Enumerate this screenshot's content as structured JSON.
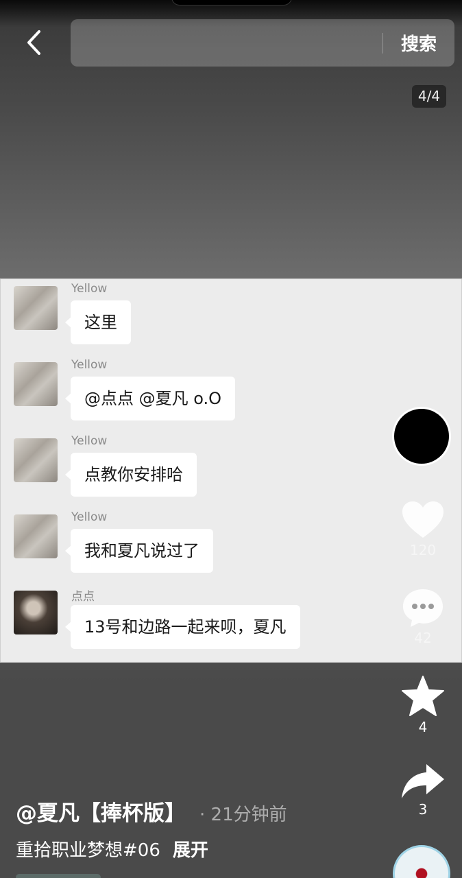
{
  "header": {
    "search_placeholder": "",
    "search_label": "搜索"
  },
  "page_indicator": "4/4",
  "chat": {
    "messages": [
      {
        "sender": "Yellow",
        "text": "这里",
        "avatar": "yellow"
      },
      {
        "sender": "Yellow",
        "text": "@点点 @夏凡 o.O",
        "avatar": "yellow"
      },
      {
        "sender": "Yellow",
        "text": "点教你安排哈",
        "avatar": "yellow"
      },
      {
        "sender": "Yellow",
        "text": "我和夏凡说过了",
        "avatar": "yellow"
      },
      {
        "sender": "点点",
        "text": "13号和边路一起来呗，夏凡",
        "avatar": "diandian"
      }
    ]
  },
  "actions": {
    "like_count": "120",
    "comment_count": "42",
    "favorite_count": "4",
    "share_count": "3"
  },
  "caption": {
    "author": "@夏凡【捧杯版】",
    "timestamp": "· 21分钟前",
    "description": "重拾职业梦想#06",
    "expand_label": "展开"
  },
  "colors": {
    "background": "#4a4a4a",
    "chat_background": "#ececec",
    "bubble": "#ffffff"
  }
}
